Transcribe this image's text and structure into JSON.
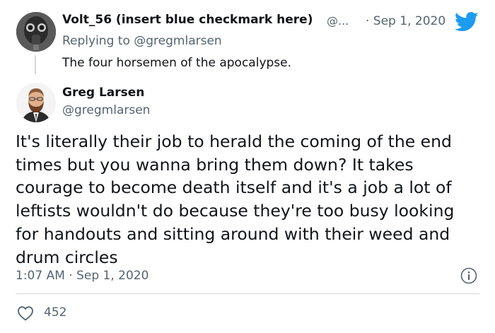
{
  "reply_tweet": {
    "display_name": "Volt_56 (insert blue checkmark here)",
    "handle": "@...",
    "date": "· Sep 1, 2020",
    "replying_prefix": "Replying to",
    "replying_to": "@gregmlarsen",
    "text": "The four horsemen of the apocalypse.",
    "avatar_icon": "gas-mask-avatar"
  },
  "main_tweet": {
    "display_name": "Greg Larsen",
    "handle": "@gregmlarsen",
    "text": "It's literally their job to herald the coming of the end\ntimes but you wanna bring them down? It takes\ncourage to become death itself and it's a job a lot of\nleftists wouldn't do because they're too busy looking\nfor handouts and sitting around with their weed and\ndrum circles",
    "timestamp": "1:07 AM · Sep 1, 2020",
    "likes": "452",
    "avatar_icon": "bearded-man-avatar"
  },
  "colors": {
    "twitter_blue": "#1d9bf0",
    "secondary_text": "#536471",
    "divider": "#cfd9de"
  }
}
